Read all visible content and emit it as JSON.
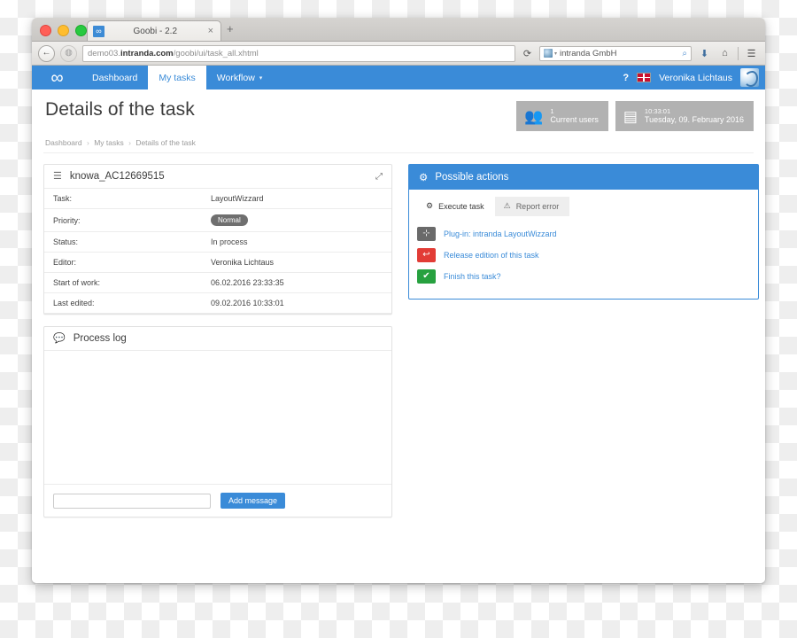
{
  "browser": {
    "tab": {
      "title": "Goobi - 2.2",
      "favicon": "infinity-icon",
      "close": "×"
    },
    "new_tab": "+",
    "back_icon": "←",
    "site_icon": "globe-icon",
    "url_prefix": "demo03.",
    "url_domain": "intranda.com",
    "url_path": "/goobi/ui/task_all.xhtml",
    "reload_icon": "⟳",
    "search": {
      "engine_icon": "search-engine-icon",
      "caret": "▾",
      "query": "intranda GmbH",
      "magnifier_icon": "⌕"
    },
    "toolbar_icons": {
      "download": "⬇",
      "home": "⌂",
      "menu": "☰"
    }
  },
  "appnav": {
    "logo": "∞",
    "items": [
      {
        "label": "Dashboard",
        "active": false,
        "caret": ""
      },
      {
        "label": "My tasks",
        "active": true,
        "caret": ""
      },
      {
        "label": "Workflow",
        "active": false,
        "caret": "▾"
      }
    ],
    "help_icon": "?",
    "language_flag": "uk-flag-icon",
    "user": "Veronika Lichtaus",
    "avatar": "user-avatar"
  },
  "page": {
    "title": "Details of the task",
    "breadcrumb": [
      "Dashboard",
      "My tasks",
      "Details of the task"
    ],
    "breadcrumb_separator": "›"
  },
  "widgets": [
    {
      "icon": "users-icon",
      "line1": "1",
      "line2": "Current users"
    },
    {
      "icon": "calendar-icon",
      "line1": "10:33:01",
      "line2": "Tuesday, 09. February 2016"
    }
  ],
  "task_card": {
    "icon": "list-icon",
    "title": "knowa_AC12669515",
    "expand_icon": "expand-arrows-icon",
    "rows": [
      {
        "key": "Task:",
        "value": "LayoutWizzard",
        "type": "text"
      },
      {
        "key": "Priority:",
        "value": "Normal",
        "type": "badge"
      },
      {
        "key": "Status:",
        "value": "In process",
        "type": "text"
      },
      {
        "key": "Editor:",
        "value": "Veronika Lichtaus",
        "type": "text"
      },
      {
        "key": "Start of work:",
        "value": "06.02.2016 23:33:35",
        "type": "text"
      },
      {
        "key": "Last edited:",
        "value": "09.02.2016 10:33:01",
        "type": "text"
      }
    ]
  },
  "process_log": {
    "icon": "comment-icon",
    "title": "Process log",
    "message_value": "",
    "message_placeholder": "",
    "add_button": "Add message"
  },
  "possible_actions": {
    "icon": "gear-icon",
    "title": "Possible actions",
    "tabs": [
      {
        "label": "Execute task",
        "icon": "gear-icon",
        "active": true
      },
      {
        "label": "Report error",
        "icon": "warning-icon",
        "active": false
      }
    ],
    "actions": [
      {
        "label": "Plug-in: intranda LayoutWizzard",
        "icon": "plugin-icon",
        "color": "#6a6a6a",
        "glyph": "⊹"
      },
      {
        "label": "Release edition of this task",
        "icon": "undo-icon",
        "color": "#e23c36",
        "glyph": "↩"
      },
      {
        "label": "Finish this task?",
        "icon": "check-icon",
        "color": "#27a13f",
        "glyph": "✔"
      }
    ]
  },
  "colors": {
    "accent_blue": "#3a8bd8",
    "widget_gray": "#b2b2b2",
    "badge_gray": "#6f6f6f",
    "danger_red": "#e23c36",
    "success_green": "#27a13f"
  }
}
